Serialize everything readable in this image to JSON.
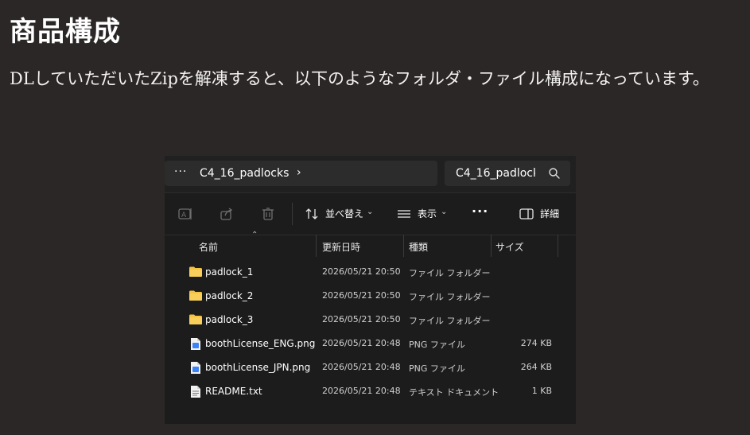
{
  "section": {
    "heading": "商品構成",
    "paragraph": "DLしていただいたZipを解凍すると、以下のようなフォルダ・ファイル構成になっています。"
  },
  "explorer": {
    "address": {
      "ellipsis": "···",
      "path": "C4_16_padlocks",
      "chevron": "›"
    },
    "search": {
      "text": "C4_16_padlock"
    },
    "toolbar": {
      "sort_label": "並べ替え",
      "view_label": "表示",
      "more_label": "···",
      "details_label": "詳細",
      "chevron": "⌄"
    },
    "columns": {
      "name": "名前",
      "modified": "更新日時",
      "type": "種類",
      "size": "サイズ"
    },
    "files": [
      {
        "name": "padlock_1",
        "modified": "2026/05/21 20:50",
        "type": "ファイル フォルダー",
        "size": "",
        "icon": "folder-icon"
      },
      {
        "name": "padlock_2",
        "modified": "2026/05/21 20:50",
        "type": "ファイル フォルダー",
        "size": "",
        "icon": "folder-icon"
      },
      {
        "name": "padlock_3",
        "modified": "2026/05/21 20:50",
        "type": "ファイル フォルダー",
        "size": "",
        "icon": "folder-icon"
      },
      {
        "name": "boothLicense_ENG.png",
        "modified": "2026/05/21 20:48",
        "type": "PNG ファイル",
        "size": "274 KB",
        "icon": "image-file-icon"
      },
      {
        "name": "boothLicense_JPN.png",
        "modified": "2026/05/21 20:48",
        "type": "PNG ファイル",
        "size": "264 KB",
        "icon": "image-file-icon"
      },
      {
        "name": "README.txt",
        "modified": "2026/05/21 20:48",
        "type": "テキスト ドキュメント",
        "size": "1 KB",
        "icon": "text-file-icon"
      }
    ]
  },
  "colors": {
    "page_background": "#2b2726",
    "window_background": "#1c1c1c",
    "folder_yellow": "#f5c242",
    "png_icon_blue": "#3b82f6"
  }
}
